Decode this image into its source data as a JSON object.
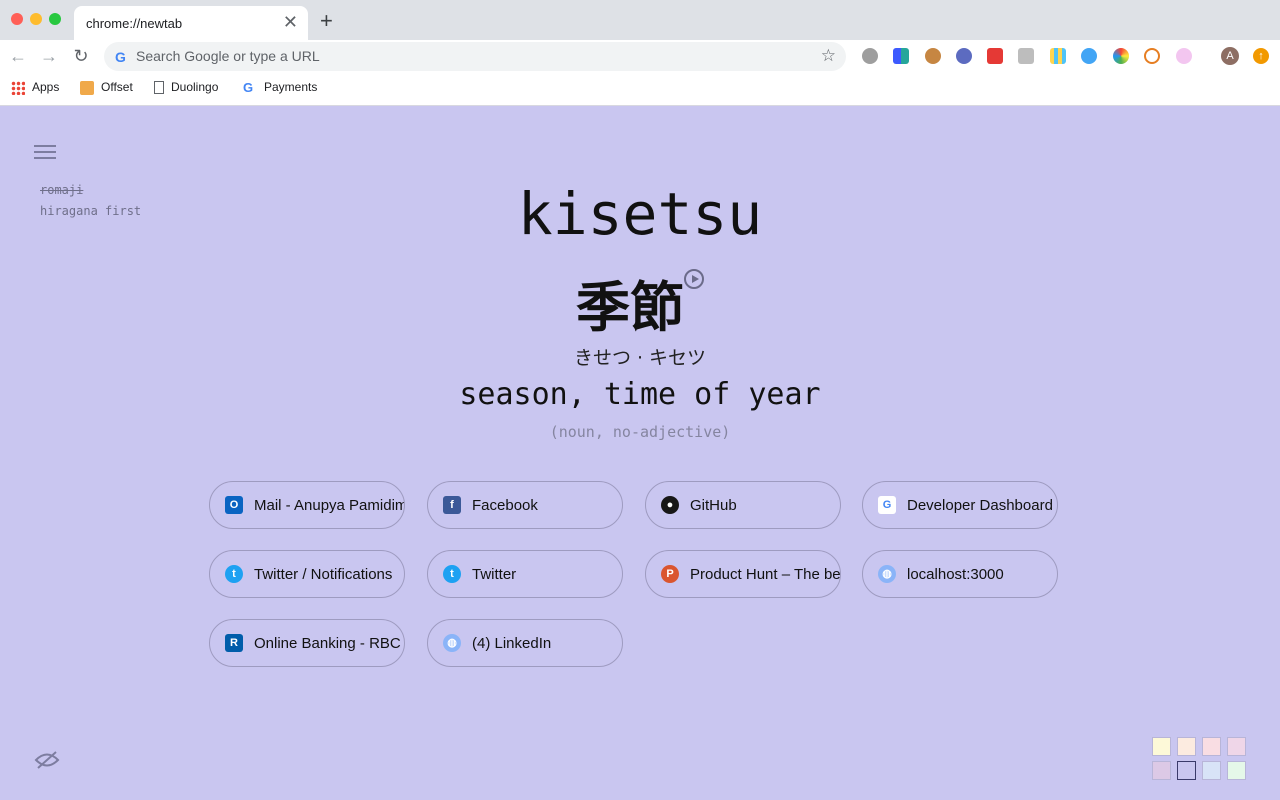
{
  "browser": {
    "tab_title": "chrome://newtab",
    "close_glyph": "✕",
    "newtab_glyph": "+",
    "back_glyph": "←",
    "forward_glyph": "→",
    "reload_glyph": "↻",
    "omnibox_g": "G",
    "omnibox_placeholder": "Search Google or type a URL",
    "star_glyph": "☆",
    "avatar_letter": "A",
    "update_glyph": "↑",
    "bookmarks": [
      {
        "label": "Apps",
        "icon": "apps-grid-icon"
      },
      {
        "label": "Offset",
        "icon": "offset-icon"
      },
      {
        "label": "Duolingo",
        "icon": "page-icon"
      },
      {
        "label": "Payments",
        "icon": "google-icon"
      }
    ]
  },
  "settings": {
    "romaji_label": "romaji",
    "hiragana_label": "hiragana first"
  },
  "word": {
    "romaji": "kisetsu",
    "kanji": "季節",
    "kana": "きせつ · キセツ",
    "meaning": "season, time of year",
    "part_of_speech": "(noun, no-adjective)"
  },
  "shortcuts": [
    {
      "label": "Mail - Anupya Pamidimukkala - Outlook",
      "icon": "outlook-icon",
      "color": "#0a64c2",
      "glyph": "O"
    },
    {
      "label": "Facebook",
      "icon": "facebook-icon",
      "color": "#3b5998",
      "glyph": "f"
    },
    {
      "label": "GitHub",
      "icon": "github-icon",
      "color": "#181717",
      "glyph": "●"
    },
    {
      "label": "Developer Dashboard - Chrome Web Store",
      "icon": "google-icon",
      "color": "#ffffff",
      "glyph": "G"
    },
    {
      "label": "Twitter / Notifications",
      "icon": "twitter-icon",
      "color": "#1da1f2",
      "glyph": "t"
    },
    {
      "label": "Twitter",
      "icon": "twitter-icon",
      "color": "#1da1f2",
      "glyph": "t"
    },
    {
      "label": "Product Hunt – The best new products",
      "icon": "product-hunt-icon",
      "color": "#da552f",
      "glyph": "P"
    },
    {
      "label": "localhost:3000",
      "icon": "globe-icon",
      "color": "#8ab4f8",
      "glyph": "◍"
    },
    {
      "label": "Online Banking - RBC Royal Bank",
      "icon": "rbc-icon",
      "color": "#005daa",
      "glyph": "R"
    },
    {
      "label": "(4) LinkedIn",
      "icon": "globe-icon",
      "color": "#8ab4f8",
      "glyph": "◍"
    }
  ],
  "theme_swatches": [
    "#fdf9d8",
    "#fcebe0",
    "#f9dde3",
    "#efd6e8",
    "#dcc9e6",
    "#c9c6f0",
    "#d8e3f7",
    "#e5f8e9"
  ],
  "selected_swatch": 5,
  "colors": {
    "background": "#c9c6f0"
  }
}
